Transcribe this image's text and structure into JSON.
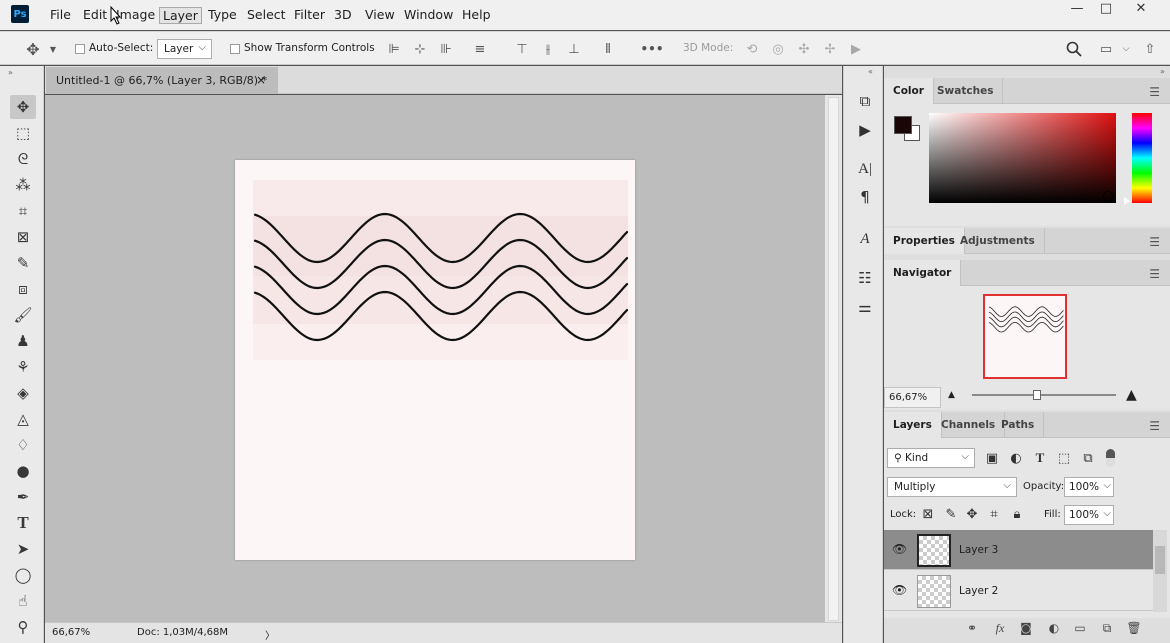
{
  "menubar": {
    "items": [
      "File",
      "Edit",
      "Image",
      "Layer",
      "Type",
      "Select",
      "Filter",
      "3D",
      "View",
      "Window",
      "Help"
    ],
    "active_item": "Layer",
    "app_logo": "Ps"
  },
  "window_controls": {
    "minimize": "—",
    "maximize": "□",
    "close": "✕"
  },
  "options": {
    "auto_select_label": "Auto-Select:",
    "auto_select_value": "Layer",
    "show_transform_label": "Show Transform Controls",
    "more_label": "•••",
    "mode_3d_label": "3D Mode:"
  },
  "document": {
    "tab_title": "Untitled-1 @ 66,7% (Layer 3, RGB/8) *",
    "tab_close": "×",
    "wave_color": "#111111",
    "background_color": "#fdf6f6"
  },
  "status": {
    "zoom": "66,67%",
    "doc_info": "Doc: 1,03M/4,68M",
    "arrow": "〉"
  },
  "panels": {
    "color_tabs": [
      "Color",
      "Swatches"
    ],
    "foreground": "#1a0606",
    "background": "#ffffff",
    "props_tabs": [
      "Properties",
      "Adjustments"
    ],
    "navigator_tab": "Navigator",
    "navigator_zoom": "66,67%",
    "layers_tabs": [
      "Layers",
      "Channels",
      "Paths"
    ],
    "kind_label": "Kind",
    "blend_mode": "Multiply",
    "opacity_label": "Opacity:",
    "opacity_value": "100%",
    "lock_label": "Lock:",
    "fill_label": "Fill:",
    "fill_value": "100%"
  },
  "layers": [
    {
      "name": "Layer 3",
      "selected": true
    },
    {
      "name": "Layer 2",
      "selected": false
    }
  ]
}
